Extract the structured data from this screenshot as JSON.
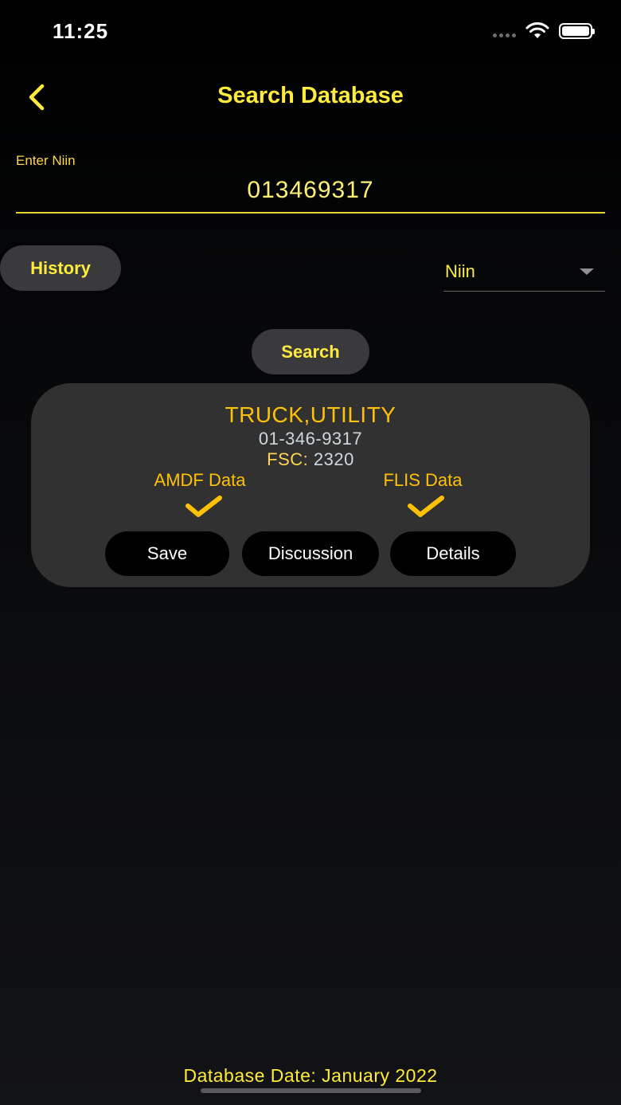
{
  "status_bar": {
    "time": "11:25"
  },
  "nav": {
    "title": "Search Database",
    "back_icon": "chevron-left-icon"
  },
  "search_field": {
    "label": "Enter Niin",
    "value": "013469317"
  },
  "buttons": {
    "history": "History",
    "search": "Search"
  },
  "dropdown": {
    "selected": "Niin"
  },
  "result": {
    "title": "TRUCK,UTILITY",
    "niin": "01-346-9317",
    "fsc_label": "FSC:",
    "fsc_value": "2320",
    "amdf_label": "AMDF Data",
    "flis_label": "FLIS Data",
    "actions": {
      "save": "Save",
      "discussion": "Discussion",
      "details": "Details"
    }
  },
  "footer": {
    "database_date": "Database Date: January 2022"
  },
  "colors": {
    "accent": "#ffeb3b",
    "accent_dark": "#ffc107",
    "card_bg": "#313132",
    "pill_bg": "#3a3a3c"
  }
}
